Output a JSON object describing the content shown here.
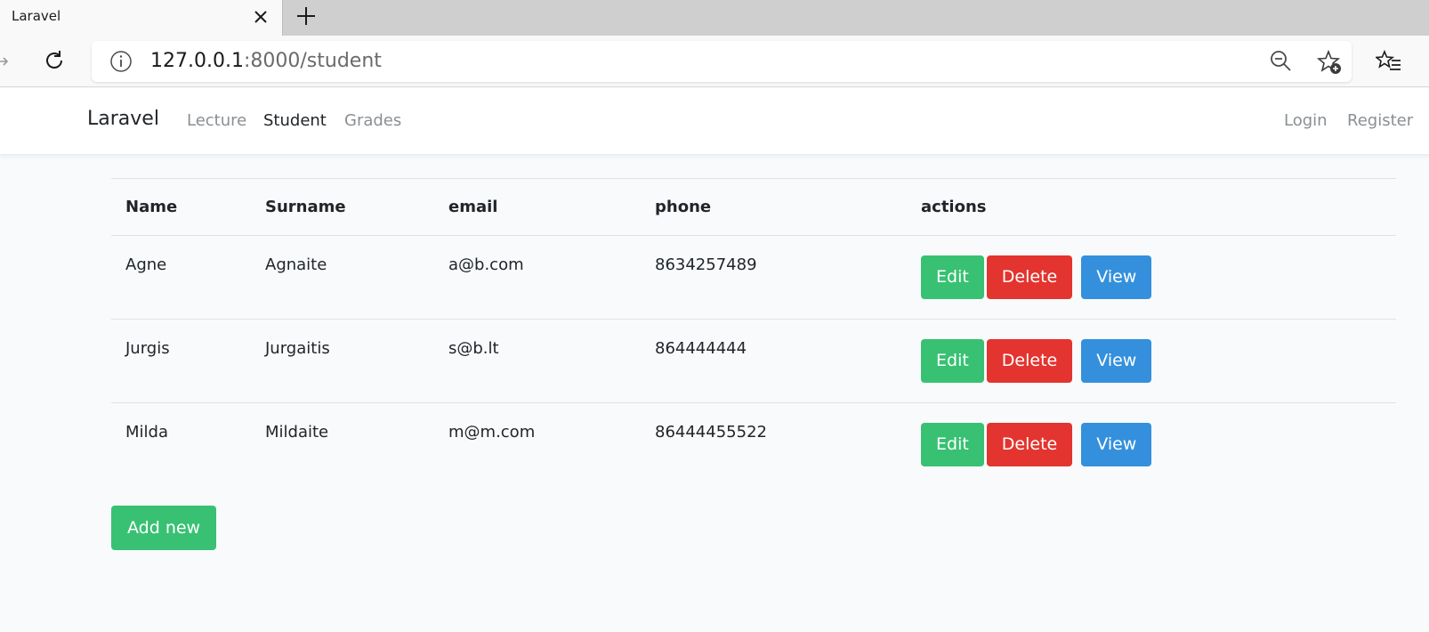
{
  "browser": {
    "tab_title": "Laravel",
    "url_host": "127.0.0.1",
    "url_rest": ":8000/student"
  },
  "navbar": {
    "brand": "Laravel",
    "links": [
      "Lecture",
      "Student",
      "Grades"
    ],
    "active_link": "Student",
    "auth_links": [
      "Login",
      "Register"
    ]
  },
  "table": {
    "headers": [
      "Name",
      "Surname",
      "email",
      "phone",
      "actions"
    ],
    "rows": [
      {
        "name": "Agne",
        "surname": "Agnaite",
        "email": "a@b.com",
        "phone": "8634257489"
      },
      {
        "name": "Jurgis",
        "surname": "Jurgaitis",
        "email": "s@b.lt",
        "phone": "864444444"
      },
      {
        "name": "Milda",
        "surname": "Mildaite",
        "email": "m@m.com",
        "phone": "86444455522"
      }
    ],
    "action_labels": {
      "edit": "Edit",
      "delete": "Delete",
      "view": "View"
    }
  },
  "add_new_label": "Add new",
  "colors": {
    "success": "#38c172",
    "danger": "#e3342f",
    "primary": "#3490dc",
    "page_bg": "#f8fafc"
  },
  "icons": [
    "close-icon",
    "plus-icon",
    "forward-icon",
    "reload-icon",
    "info-icon",
    "zoom-out-icon",
    "star-add-icon",
    "favorites-list-icon"
  ]
}
